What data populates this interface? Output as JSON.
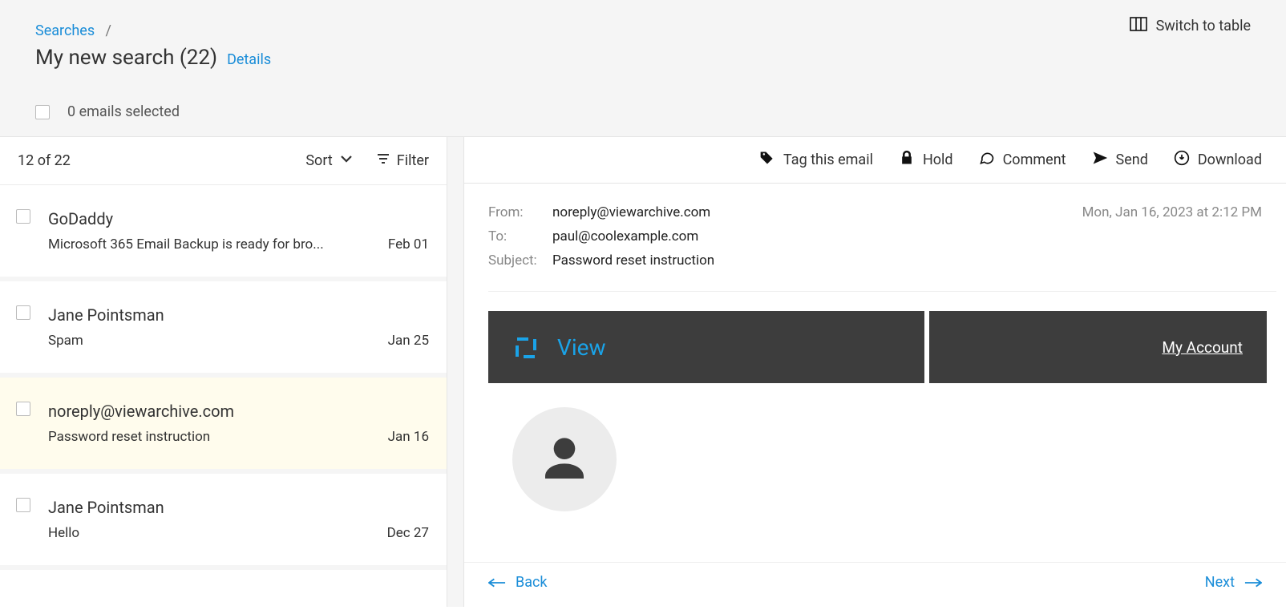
{
  "header": {
    "breadcrumb_root": "Searches",
    "breadcrumb_sep": "/",
    "title": "My new search (22)",
    "details_label": "Details",
    "switch_table_label": "Switch to table",
    "selected_label": "0 emails selected"
  },
  "list": {
    "counter": "12 of 22",
    "sort_label": "Sort",
    "filter_label": "Filter",
    "items": [
      {
        "sender": "GoDaddy",
        "subject": "Microsoft 365 Email Backup is ready for bro...",
        "date": "Feb 01",
        "selected": false
      },
      {
        "sender": "Jane Pointsman",
        "subject": "Spam",
        "date": "Jan 25",
        "selected": false
      },
      {
        "sender": "noreply@viewarchive.com",
        "subject": "Password reset instruction",
        "date": "Jan 16",
        "selected": true
      },
      {
        "sender": "Jane Pointsman",
        "subject": "Hello",
        "date": "Dec 27",
        "selected": false
      }
    ]
  },
  "toolbar": {
    "tag_label": "Tag this email",
    "hold_label": "Hold",
    "comment_label": "Comment",
    "send_label": "Send",
    "download_label": "Download"
  },
  "detail": {
    "from_label": "From:",
    "from_value": "noreply@viewarchive.com",
    "to_label": "To:",
    "to_value": "paul@coolexample.com",
    "subject_label": "Subject:",
    "subject_value": "Password reset instruction",
    "timestamp": "Mon, Jan 16, 2023 at 2:12 PM",
    "body": {
      "brand": "View",
      "account_link": "My Account"
    }
  },
  "nav": {
    "back": "Back",
    "next": "Next"
  }
}
